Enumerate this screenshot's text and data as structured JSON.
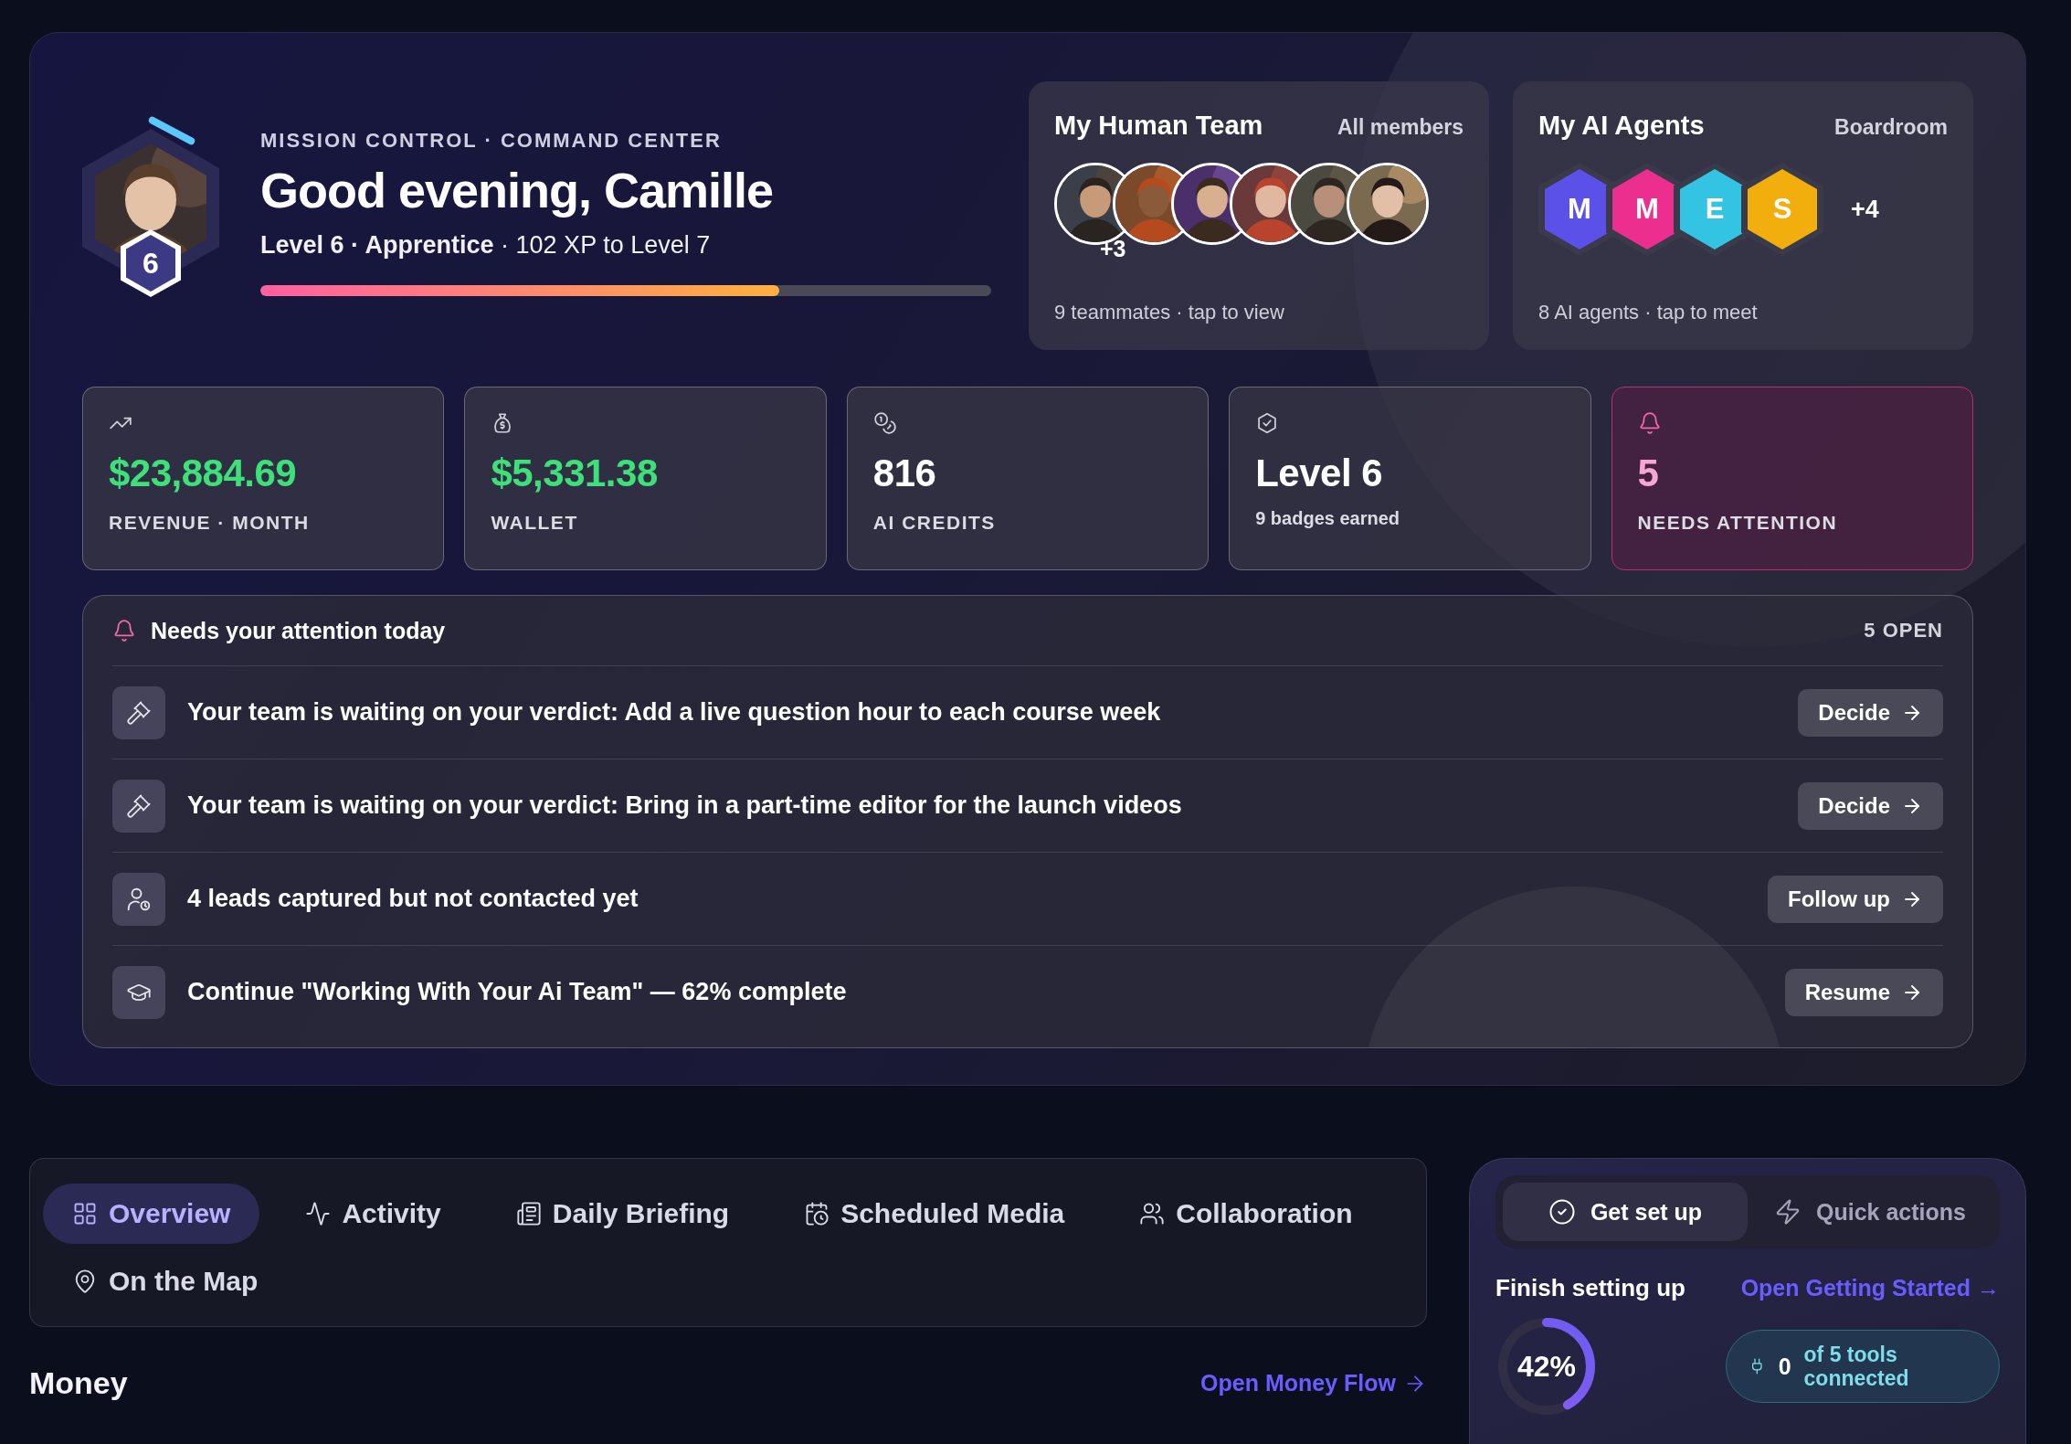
{
  "header": {
    "eyebrow": "MISSION CONTROL · COMMAND CENTER",
    "greeting": "Good evening, Camille",
    "level_line": "**Level 6 · Apprentice** · 102 XP to Level 7",
    "badge": "6",
    "xp": {
      "level": 0.71
    }
  },
  "human_team": {
    "title": "My Human Team",
    "link": "All members",
    "overflow": "+3",
    "caption": "9 teammates · tap to view"
  },
  "ai_agents": {
    "title": "My AI Agents",
    "link": "Boardroom",
    "agents": [
      {
        "initial": "M",
        "color": "#5b50e8"
      },
      {
        "initial": "M",
        "color": "#ec2f8e"
      },
      {
        "initial": "E",
        "color": "#33c3e3"
      },
      {
        "initial": "S",
        "color": "#f1ae0c"
      }
    ],
    "overflow": "+4",
    "caption": "8 AI agents · tap to meet"
  },
  "stats": [
    {
      "kind": "revenue",
      "value": "$23,884.69",
      "label": "REVENUE · MONTH"
    },
    {
      "kind": "wallet",
      "value": "$5,331.38",
      "label": "WALLET"
    },
    {
      "kind": "credits",
      "value": "816",
      "label": "AI CREDITS"
    },
    {
      "kind": "badges",
      "value": "Level 6",
      "label": "9 badges earned"
    },
    {
      "kind": "alert",
      "value": "5",
      "label": "NEEDS ATTENTION"
    }
  ],
  "attention": {
    "title": "Needs your attention today",
    "count": "5 OPEN",
    "items": [
      {
        "kind": "verdict",
        "text": "Your team is waiting on your verdict: Add a live question hour to each course week",
        "action": "Decide"
      },
      {
        "kind": "verdict",
        "text": "Your team is waiting on your verdict: Bring in a part-time editor for the launch videos",
        "action": "Decide"
      },
      {
        "kind": "leads",
        "text": "4 leads captured but not contacted yet",
        "action": "Follow up"
      },
      {
        "kind": "course",
        "text": "Continue \"Working With Your Ai Team\" — 62% complete",
        "action": "Resume"
      }
    ]
  },
  "tabs": [
    {
      "label": "Overview",
      "kind": "overview",
      "selected": true
    },
    {
      "label": "Activity",
      "kind": "activity",
      "selected": false
    },
    {
      "label": "Daily Briefing",
      "kind": "briefing",
      "selected": false
    },
    {
      "label": "Scheduled Media",
      "kind": "media",
      "selected": false
    },
    {
      "label": "Collaboration",
      "kind": "collaboration",
      "selected": false
    },
    {
      "label": "On the Map",
      "kind": "map",
      "selected": false
    }
  ],
  "money": {
    "title": "Money",
    "link": "Open Money Flow"
  },
  "setup": {
    "tabs": [
      {
        "label": "Get set up",
        "kind": "setup",
        "selected": true
      },
      {
        "label": "Quick actions",
        "kind": "quick",
        "selected": false
      }
    ],
    "title": "Finish setting up",
    "link": "Open Getting Started →",
    "progress": {
      "level": 0.42,
      "reading": "42%"
    },
    "tools": {
      "count": "0",
      "text": "of 5 tools connected"
    }
  }
}
